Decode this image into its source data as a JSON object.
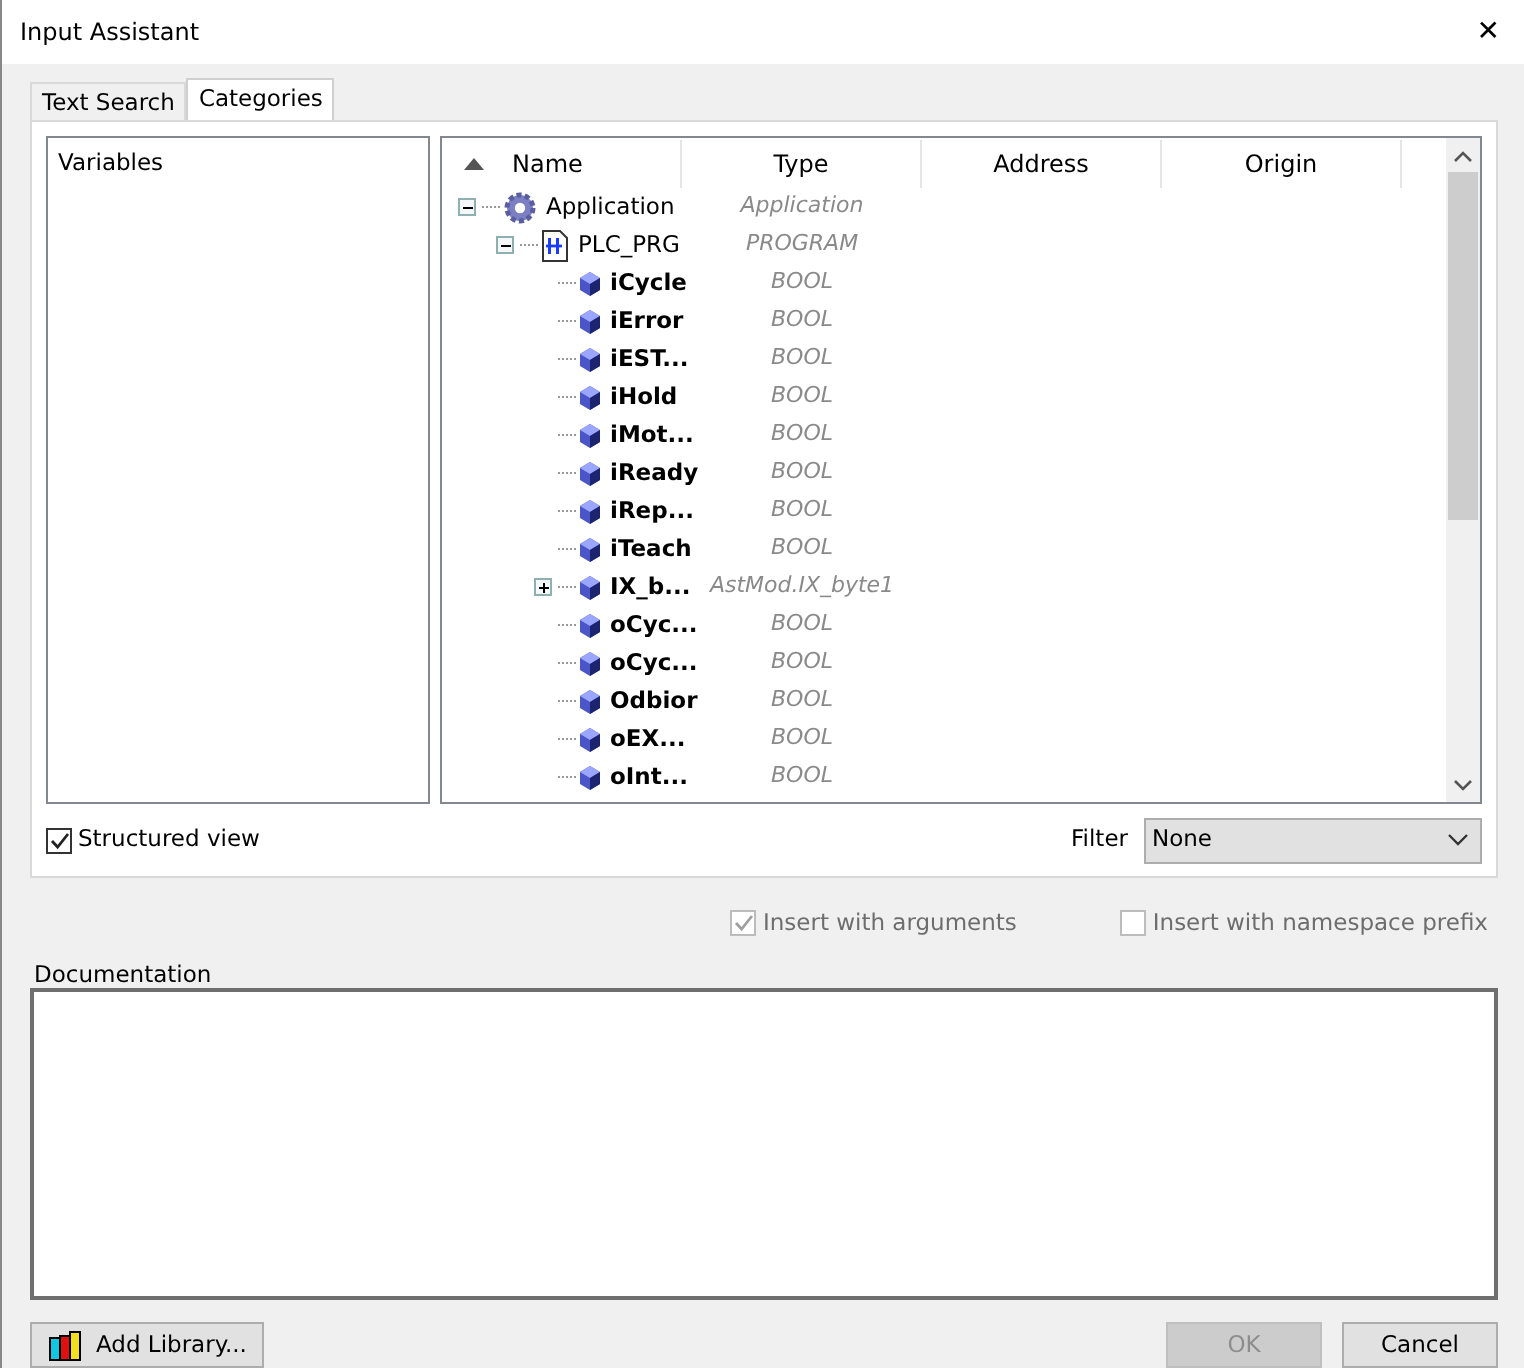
{
  "window": {
    "title": "Input Assistant",
    "close": "✕"
  },
  "tabs": [
    {
      "label": "Text Search",
      "selected": false
    },
    {
      "label": "Categories",
      "selected": true
    }
  ],
  "categories": [
    {
      "label": "Variables",
      "selected": false
    }
  ],
  "table": {
    "columns": [
      "Name",
      "Type",
      "Address",
      "Origin"
    ],
    "rows": [
      {
        "kind": "application",
        "name": "Application",
        "type": "Application",
        "expanded": true,
        "children": [
          {
            "kind": "program",
            "name": "PLC_PRG",
            "type": "PROGRAM",
            "expanded": true,
            "children": [
              {
                "kind": "variable",
                "name": "iCycle",
                "type": "BOOL"
              },
              {
                "kind": "variable",
                "name": "iError",
                "type": "BOOL"
              },
              {
                "kind": "variable",
                "name": "iEST...",
                "type": "BOOL"
              },
              {
                "kind": "variable",
                "name": "iHold",
                "type": "BOOL"
              },
              {
                "kind": "variable",
                "name": "iMot...",
                "type": "BOOL"
              },
              {
                "kind": "variable",
                "name": "iReady",
                "type": "BOOL"
              },
              {
                "kind": "variable",
                "name": "iRep...",
                "type": "BOOL"
              },
              {
                "kind": "variable",
                "name": "iTeach",
                "type": "BOOL"
              },
              {
                "kind": "variable",
                "name": "IX_b...",
                "type": "AstMod.IX_byte1",
                "expanded": false
              },
              {
                "kind": "variable",
                "name": "oCyc...",
                "type": "BOOL"
              },
              {
                "kind": "variable",
                "name": "oCyc...",
                "type": "BOOL"
              },
              {
                "kind": "variable",
                "name": "Odbior",
                "type": "BOOL"
              },
              {
                "kind": "variable",
                "name": "oEX...",
                "type": "BOOL"
              },
              {
                "kind": "variable",
                "name": "oInt...",
                "type": "BOOL"
              }
            ]
          }
        ]
      }
    ]
  },
  "structured_view": {
    "label": "Structured view",
    "checked": true
  },
  "filter": {
    "label": "Filter",
    "value": "None"
  },
  "options": [
    {
      "label": "Insert with arguments",
      "checked": true,
      "disabled": true
    },
    {
      "label": "Insert with namespace prefix",
      "checked": false,
      "disabled": true
    }
  ],
  "documentation": {
    "label": "Documentation"
  },
  "buttons": [
    {
      "kind": "library",
      "label": "Add Library...",
      "disabled": false
    },
    {
      "kind": "ok",
      "label": "OK",
      "disabled": true
    },
    {
      "kind": "cancel",
      "label": "Cancel",
      "disabled": false
    }
  ]
}
